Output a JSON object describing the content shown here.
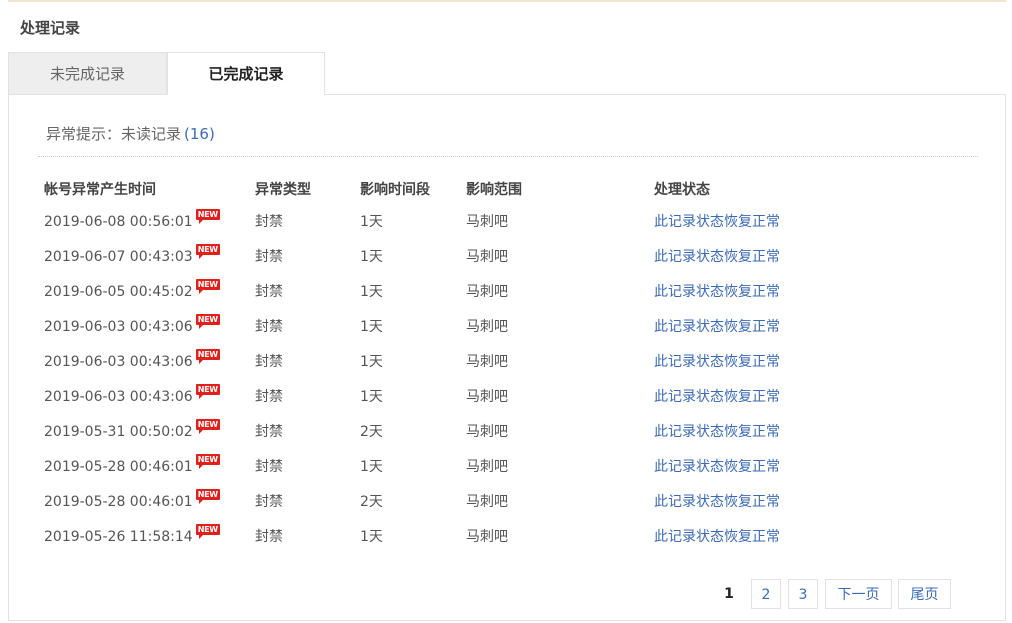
{
  "page": {
    "title": "处理记录"
  },
  "tabs": [
    {
      "label": "未完成记录",
      "active": false
    },
    {
      "label": "已完成记录",
      "active": true
    }
  ],
  "alert": {
    "label": "异常提示：未读记录",
    "count": "(16)"
  },
  "table": {
    "headers": [
      "帐号异常产生时间",
      "异常类型",
      "影响时间段",
      "影响范围",
      "处理状态"
    ],
    "badge": "NEW",
    "rows": [
      {
        "time": "2019-06-08 00:56:01",
        "type": "封禁",
        "period": "1天",
        "scope": "马刺吧",
        "status": "此记录状态恢复正常"
      },
      {
        "time": "2019-06-07 00:43:03",
        "type": "封禁",
        "period": "1天",
        "scope": "马刺吧",
        "status": "此记录状态恢复正常"
      },
      {
        "time": "2019-06-05 00:45:02",
        "type": "封禁",
        "period": "1天",
        "scope": "马刺吧",
        "status": "此记录状态恢复正常"
      },
      {
        "time": "2019-06-03 00:43:06",
        "type": "封禁",
        "period": "1天",
        "scope": "马刺吧",
        "status": "此记录状态恢复正常"
      },
      {
        "time": "2019-06-03 00:43:06",
        "type": "封禁",
        "period": "1天",
        "scope": "马刺吧",
        "status": "此记录状态恢复正常"
      },
      {
        "time": "2019-06-03 00:43:06",
        "type": "封禁",
        "period": "1天",
        "scope": "马刺吧",
        "status": "此记录状态恢复正常"
      },
      {
        "time": "2019-05-31 00:50:02",
        "type": "封禁",
        "period": "2天",
        "scope": "马刺吧",
        "status": "此记录状态恢复正常"
      },
      {
        "time": "2019-05-28 00:46:01",
        "type": "封禁",
        "period": "1天",
        "scope": "马刺吧",
        "status": "此记录状态恢复正常"
      },
      {
        "time": "2019-05-28 00:46:01",
        "type": "封禁",
        "period": "2天",
        "scope": "马刺吧",
        "status": "此记录状态恢复正常"
      },
      {
        "time": "2019-05-26 11:58:14",
        "type": "封禁",
        "period": "1天",
        "scope": "马刺吧",
        "status": "此记录状态恢复正常"
      }
    ]
  },
  "pagination": {
    "current": "1",
    "pages": [
      "2",
      "3"
    ],
    "next_label": "下一页",
    "last_label": "尾页"
  },
  "colors": {
    "link": "#3c6bb3",
    "badge": "#e0211b",
    "top_rule": "#efe6d2"
  }
}
